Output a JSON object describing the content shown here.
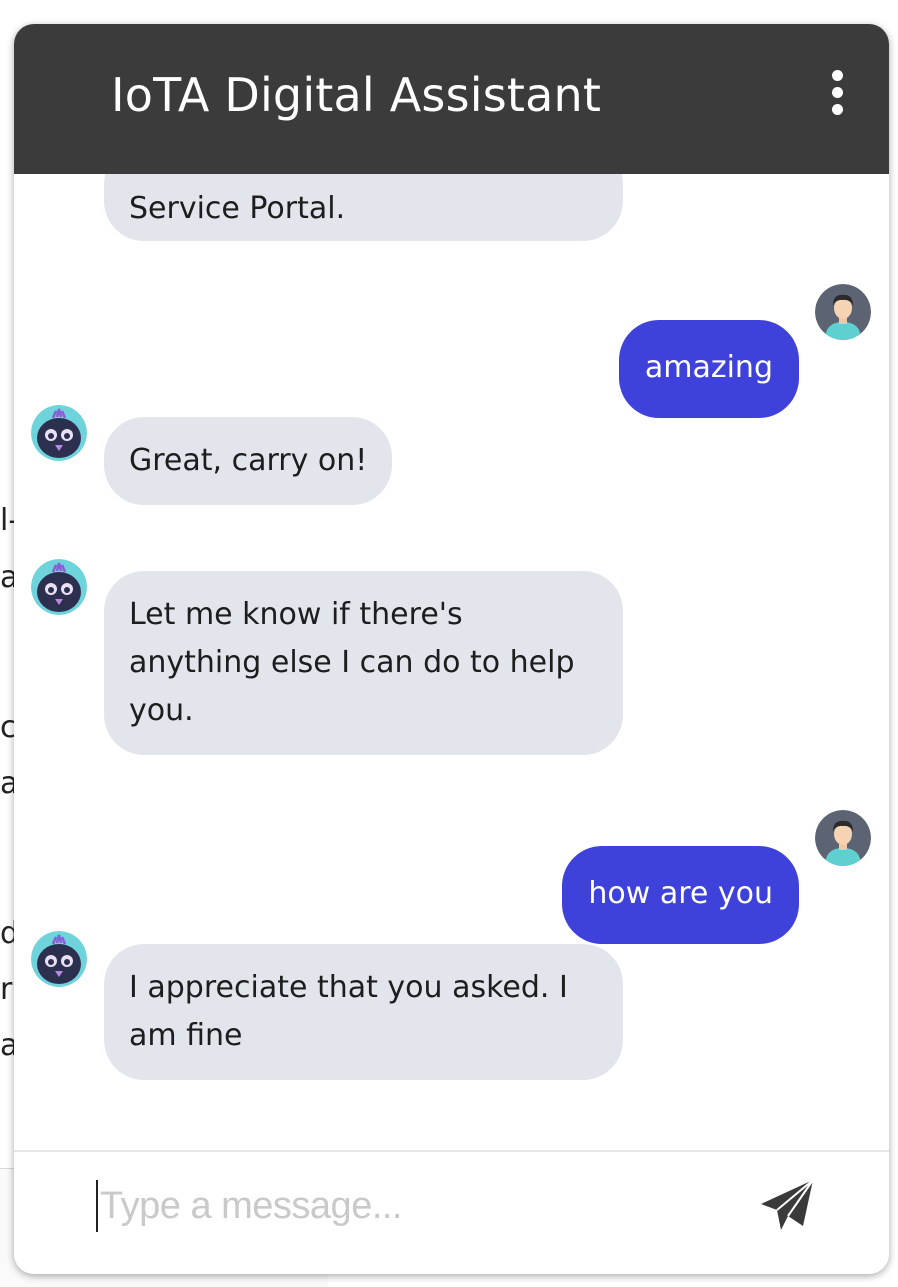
{
  "header": {
    "title": "IoTA Digital Assistant",
    "menu_icon": "kebab-menu-icon"
  },
  "messages": [
    {
      "sender": "bot",
      "text": "Service Portal."
    },
    {
      "sender": "user",
      "text": "amazing"
    },
    {
      "sender": "bot",
      "text": "Great, carry on!"
    },
    {
      "sender": "bot",
      "text": "Let me know if there's anything else I can do to help you."
    },
    {
      "sender": "user",
      "text": "how are you"
    },
    {
      "sender": "bot",
      "text": "I appreciate that you asked. I am fine"
    }
  ],
  "composer": {
    "placeholder": "Type a message...",
    "value": "",
    "send_icon": "paper-plane-icon"
  },
  "background_fragments": [
    "l-",
    "a",
    "c",
    "a",
    "d",
    "r",
    "a"
  ],
  "colors": {
    "header_bg": "#3b3b3b",
    "user_bubble": "#3e41da",
    "bot_bubble": "#e2e6ec",
    "bot_avatar_bg": "#6fd3dc",
    "user_avatar_bg": "#5c6473"
  }
}
